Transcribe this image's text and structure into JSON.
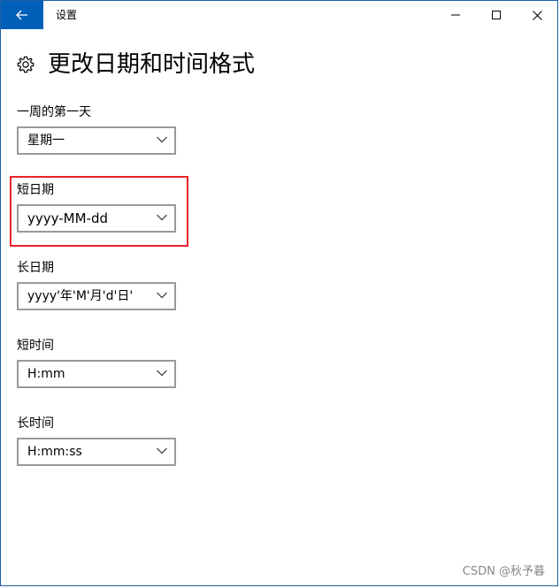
{
  "window": {
    "title": "设置"
  },
  "page": {
    "title": "更改日期和时间格式"
  },
  "fields": [
    {
      "label": "一周的第一天",
      "value": "星期一"
    },
    {
      "label": "短日期",
      "value": "yyyy-MM-dd"
    },
    {
      "label": "长日期",
      "value": "yyyy'年'M'月'd'日'"
    },
    {
      "label": "短时间",
      "value": "H:mm"
    },
    {
      "label": "长时间",
      "value": "H:mm:ss"
    }
  ],
  "watermark": "CSDN @秋予暮",
  "icons": {
    "back": "back-arrow-icon",
    "minimize": "minimize-icon",
    "maximize": "maximize-icon",
    "close": "close-icon",
    "settings": "gear-icon",
    "dropdown": "chevron-down-icon"
  },
  "colors": {
    "accent": "#005fb8",
    "highlight_box": "#e8242b",
    "select_border": "#999999"
  }
}
